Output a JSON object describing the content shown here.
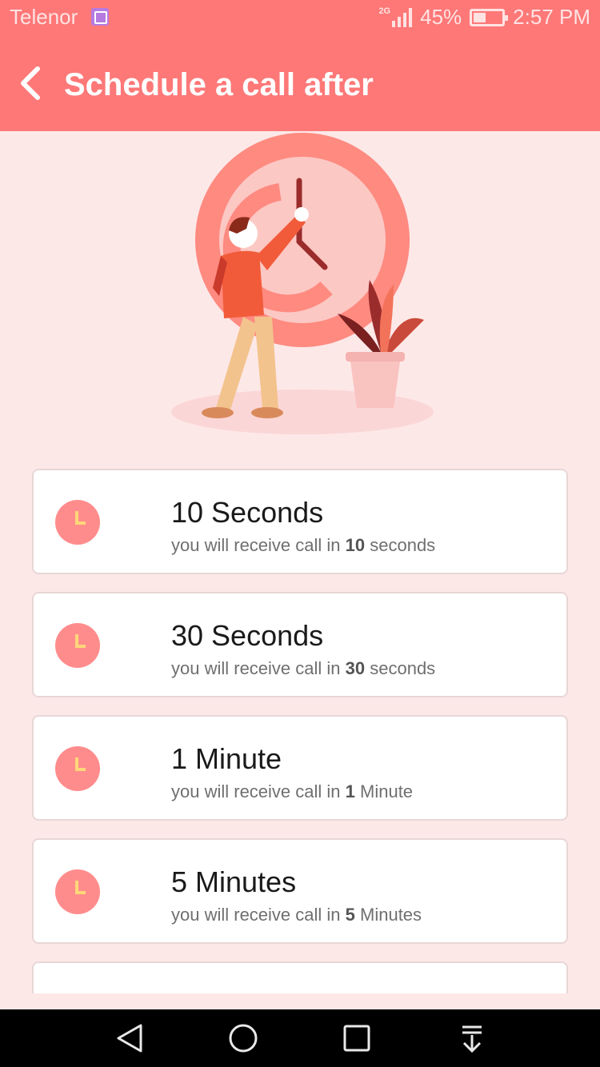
{
  "status": {
    "carrier": "Telenor",
    "network": "2G",
    "battery": "45%",
    "time": "2:57 PM",
    "battery_level": 0.45,
    "icons": [
      "gallery-icon",
      "signal-icon",
      "battery-icon"
    ]
  },
  "header": {
    "title": "Schedule a call after",
    "back_icon": "chevron-left-icon"
  },
  "colors": {
    "primary": "#fe7878",
    "background": "#fde8e8",
    "accent_clock": "#ff8c8c",
    "clock_hands": "#ffd67a"
  },
  "options": [
    {
      "title": "10 Seconds",
      "sub_prefix": "you will receive call in ",
      "sub_value": "10",
      "sub_suffix": " seconds"
    },
    {
      "title": "30 Seconds",
      "sub_prefix": "you will receive call in ",
      "sub_value": "30",
      "sub_suffix": " seconds"
    },
    {
      "title": "1 Minute",
      "sub_prefix": "you will receive call in ",
      "sub_value": "1",
      "sub_suffix": " Minute"
    },
    {
      "title": "5 Minutes",
      "sub_prefix": "you will receive call in ",
      "sub_value": "5",
      "sub_suffix": " Minutes"
    }
  ],
  "nav": {
    "icons": [
      "back-nav-icon",
      "home-nav-icon",
      "recents-nav-icon",
      "notifications-pull-icon"
    ]
  }
}
